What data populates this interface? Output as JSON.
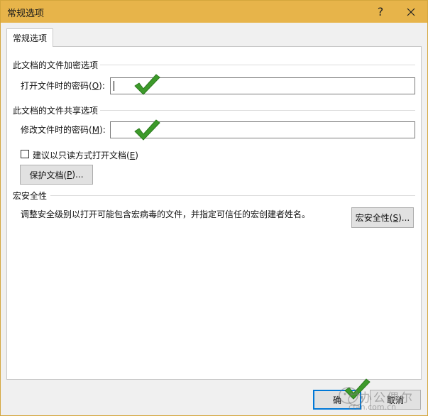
{
  "window": {
    "title": "常规选项",
    "help_glyph": "?",
    "title_bar_color": "#e7b44a"
  },
  "tabs": [
    {
      "label": "常规选项",
      "selected": true
    }
  ],
  "encryption": {
    "heading": "此文档的文件加密选项",
    "open_password_label_prefix": "打开文件时的密码(",
    "open_password_label_key": "O",
    "open_password_label_suffix": "):",
    "open_password_value": ""
  },
  "sharing": {
    "heading": "此文档的文件共享选项",
    "modify_password_label_prefix": "修改文件时的密码(",
    "modify_password_label_key": "M",
    "modify_password_label_suffix": "):",
    "modify_password_value": "",
    "readonly_checkbox": {
      "label_prefix": "建议以只读方式打开文档(",
      "label_key": "E",
      "label_suffix": ")",
      "checked": false
    },
    "protect_button": {
      "label_prefix": "保护文档(",
      "label_key": "P",
      "label_suffix": ")..."
    }
  },
  "macro": {
    "heading": "宏安全性",
    "description": "调整安全级别以打开可能包含宏病毒的文件，并指定可信任的宏创建者姓名。",
    "button": {
      "label_prefix": "宏安全性(",
      "label_key": "S",
      "label_suffix": ")..."
    }
  },
  "footer": {
    "ok_label": "确",
    "cancel_label": "取消"
  },
  "watermark": {
    "text": "办公偶尔",
    "url": "cfan.com.cn"
  },
  "icons": {
    "annotation": "green-check-icon",
    "close": "close-icon",
    "help": "help-icon"
  },
  "colors": {
    "check_green": "#3d9a2b",
    "default_button_border": "#0078d7"
  }
}
